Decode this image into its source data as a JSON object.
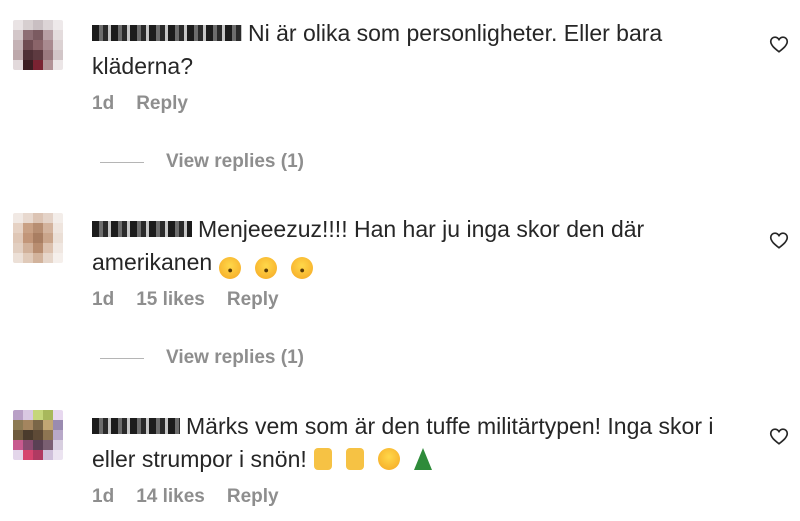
{
  "comments": [
    {
      "text": "Ni är olika som personligheter. Eller bara kläderna?",
      "time": "1d",
      "likes": "",
      "reply": "Reply",
      "view_replies": "View replies (1)",
      "emojis": []
    },
    {
      "text": "Menjeeezuz!!!! Han har ju inga skor den där amerikanen",
      "time": "1d",
      "likes": "15 likes",
      "reply": "Reply",
      "view_replies": "View replies (1)",
      "emojis": [
        "astonished-face-emoji",
        "astonished-face-emoji",
        "astonished-face-emoji"
      ]
    },
    {
      "text": "Märks vem som är den tuffe militärtypen! Inga skor i eller strumpor i snön!",
      "time": "1d",
      "likes": "14 likes",
      "reply": "Reply",
      "view_replies": "",
      "emojis": [
        "flexed-biceps-emoji",
        "sign-of-horns-emoji",
        "tears-of-joy-emoji",
        "christmas-tree-emoji"
      ]
    }
  ],
  "icons": {
    "like": "heart-outline-icon"
  },
  "colors": {
    "text": "#262626",
    "secondary": "#8e8e8e",
    "divider": "#b5b5b5"
  }
}
